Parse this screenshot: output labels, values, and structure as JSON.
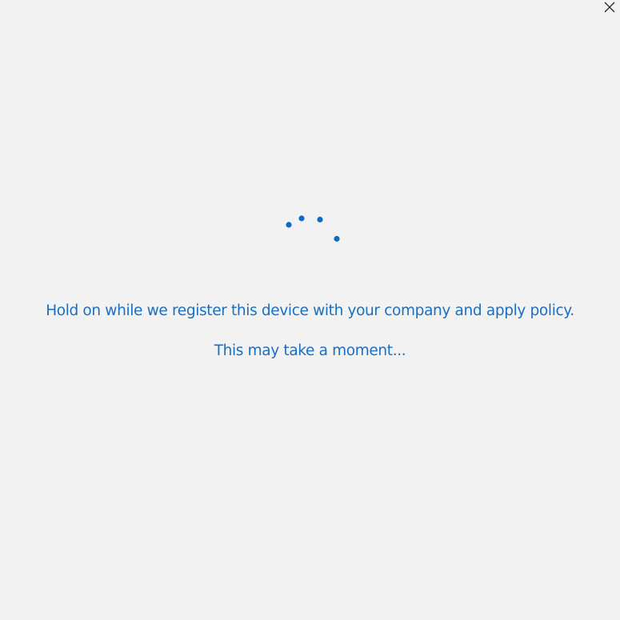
{
  "window": {
    "close_icon": "close-icon"
  },
  "spinner": {
    "icon": "loading-spinner-icon",
    "color": "#0f6cc6"
  },
  "messages": {
    "primary": "Hold on while we register this device with your company and apply policy.",
    "secondary": "This may take a moment..."
  },
  "colors": {
    "background": "#f2f2f2",
    "text_accent": "#1a6fc0"
  }
}
